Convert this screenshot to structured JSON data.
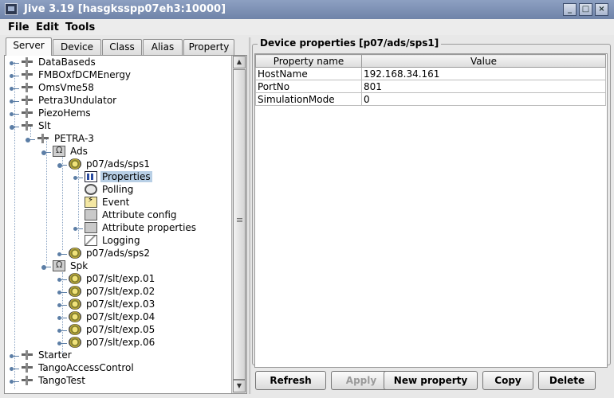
{
  "window": {
    "title": "Jive 3.19  [hasgksspp07eh3:10000]"
  },
  "menu": [
    "File",
    "Edit",
    "Tools"
  ],
  "tabs": [
    {
      "label": "Server",
      "active": true
    },
    {
      "label": "Device"
    },
    {
      "label": "Class"
    },
    {
      "label": "Alias"
    },
    {
      "label": "Property"
    }
  ],
  "tree": [
    {
      "label": "DataBaseds",
      "icon": "server-icon"
    },
    {
      "label": "FMBOxfDCMEnergy",
      "icon": "server-icon"
    },
    {
      "label": "OmsVme58",
      "icon": "server-icon"
    },
    {
      "label": "Petra3Undulator",
      "icon": "server-icon"
    },
    {
      "label": "PiezoHems",
      "icon": "server-icon"
    },
    {
      "label": "Slt",
      "icon": "server-icon"
    },
    {
      "label": "PETRA-3",
      "icon": "server-icon"
    },
    {
      "label": "Ads",
      "icon": "class-icon"
    },
    {
      "label": "p07/ads/sps1",
      "icon": "device-icon"
    },
    {
      "label": "Properties",
      "icon": "properties-icon",
      "selected": true
    },
    {
      "label": "Polling",
      "icon": "polling-icon"
    },
    {
      "label": "Event",
      "icon": "event-icon"
    },
    {
      "label": "Attribute config",
      "icon": "attribute-config-icon"
    },
    {
      "label": "Attribute properties",
      "icon": "attribute-properties-icon"
    },
    {
      "label": "Logging",
      "icon": "logging-icon"
    },
    {
      "label": "p07/ads/sps2",
      "icon": "device-icon"
    },
    {
      "label": "Spk",
      "icon": "class-icon"
    },
    {
      "label": "p07/slt/exp.01",
      "icon": "device-icon"
    },
    {
      "label": "p07/slt/exp.02",
      "icon": "device-icon"
    },
    {
      "label": "p07/slt/exp.03",
      "icon": "device-icon"
    },
    {
      "label": "p07/slt/exp.04",
      "icon": "device-icon"
    },
    {
      "label": "p07/slt/exp.05",
      "icon": "device-icon"
    },
    {
      "label": "p07/slt/exp.06",
      "icon": "device-icon"
    },
    {
      "label": "Starter",
      "icon": "server-icon"
    },
    {
      "label": "TangoAccessControl",
      "icon": "server-icon"
    },
    {
      "label": "TangoTest",
      "icon": "server-icon"
    }
  ],
  "panel": {
    "title": "Device properties [p07/ads/sps1]",
    "columns": [
      "Property name",
      "Value"
    ],
    "rows": [
      {
        "name": "HostName",
        "value": "192.168.34.161"
      },
      {
        "name": "PortNo",
        "value": "801"
      },
      {
        "name": "SimulationMode",
        "value": "0"
      }
    ]
  },
  "buttons": {
    "refresh": "Refresh",
    "apply": "Apply",
    "new_property": "New property",
    "copy": "Copy",
    "delete": "Delete"
  }
}
